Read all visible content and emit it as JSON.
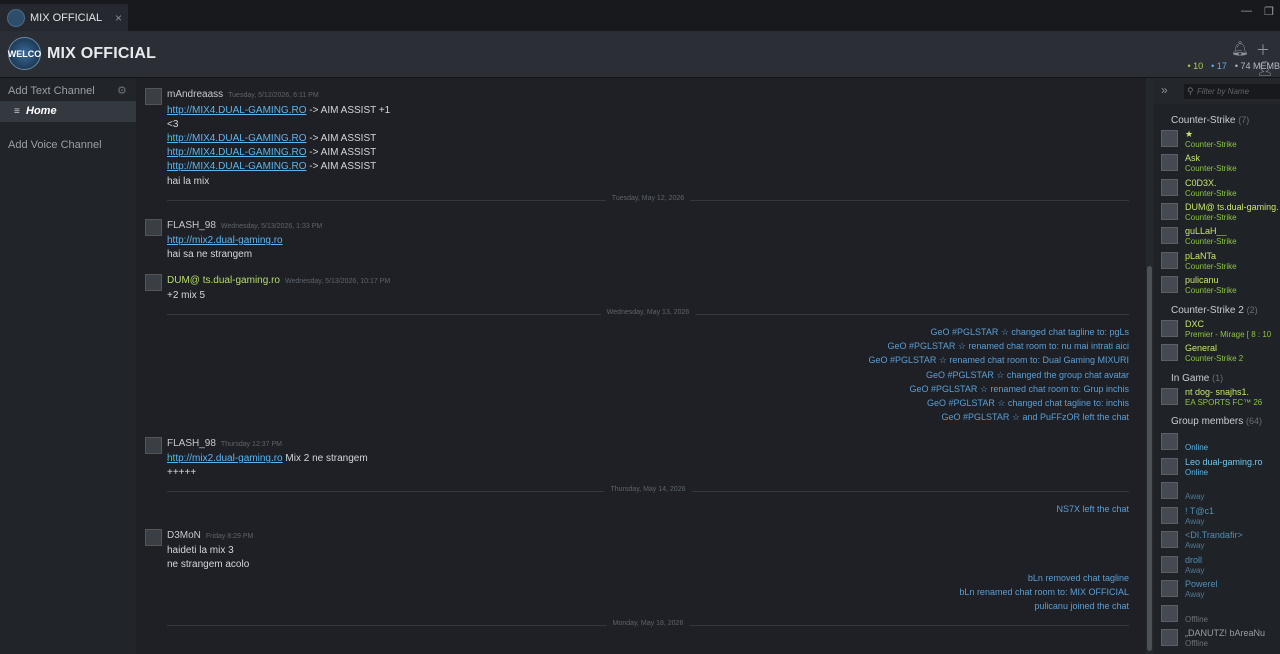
{
  "tab": {
    "title": "MIX OFFICIAL",
    "close": "×"
  },
  "header": {
    "title": "MIX OFFICIAL",
    "logo_text": "WELCO",
    "counts": {
      "in_game": "10",
      "online": "17",
      "members": "74 MEMB"
    }
  },
  "left": {
    "add_text": "Add Text Channel",
    "home": "Home",
    "add_voice": "Add Voice Channel"
  },
  "messages": [
    {
      "name": "mAndreaass",
      "ts": "Tuesday, 5/12/2026, 6:11 PM",
      "lines": [
        {
          "link": "http://MIX4.DUAL-GAMING.RO",
          "text": " -> AIM ASSIST +1"
        },
        {
          "text": "<3"
        },
        {
          "link": "http://MIX4.DUAL-GAMING.RO",
          "text": " -> AIM ASSIST"
        },
        {
          "link": "http://MIX4.DUAL-GAMING.RO",
          "text": " -> AIM ASSIST"
        },
        {
          "link": "http://MIX4.DUAL-GAMING.RO",
          "text": " -> AIM ASSIST"
        },
        {
          "text": "hai la mix"
        }
      ]
    },
    {
      "name": "FLASH_98",
      "ts": "Wednesday, 5/13/2026, 1:33 PM",
      "lines": [
        {
          "link": "http://mix2.dual-gaming.ro",
          "text": ""
        },
        {
          "text": "hai sa ne strangem"
        }
      ]
    },
    {
      "name": "DUM@ ts.dual-gaming.ro",
      "ts": "Wednesday, 5/13/2026, 10:17 PM",
      "lines": [
        {
          "text": "+2 mix 5"
        }
      ]
    },
    {
      "name": "FLASH_98",
      "ts": "Thursday 12:37 PM",
      "lines": [
        {
          "link": "http://mix2.dual-gaming.ro",
          "text": " Mix 2 ne strangem"
        },
        {
          "text": "+++++"
        }
      ]
    },
    {
      "name": "D3MoN",
      "ts": "Friday 8:29 PM",
      "lines": [
        {
          "text": "haideti la mix 3"
        },
        {
          "text": "ne strangem acolo"
        }
      ]
    }
  ],
  "separators": [
    "Tuesday, May 12, 2026",
    "Wednesday, May 13, 2026",
    "Thursday, May 14, 2026",
    "Monday, May 18, 2026"
  ],
  "system": {
    "block1": [
      "GeO #PGLSTAR ☆ changed chat tagline to: pgLs",
      "GeO #PGLSTAR ☆ renamed chat room to: nu mai intrati aici",
      "GeO #PGLSTAR ☆ renamed chat room to: Dual Gaming MIXURI",
      "GeO #PGLSTAR ☆ changed the group chat avatar",
      "GeO #PGLSTAR ☆ renamed chat room to: Grup inchis",
      "GeO #PGLSTAR ☆ changed chat tagline to: inchis",
      "GeO #PGLSTAR ☆ and PuFFzOR left the chat"
    ],
    "block2": [
      "NS7X left the chat"
    ],
    "block3": [
      "bLn removed chat tagline",
      "bLn renamed chat room to: MIX OFFICIAL",
      "pulicanu joined the chat"
    ]
  },
  "right": {
    "filter": "Filter by Name",
    "groups": [
      {
        "title": "Counter-Strike",
        "count": "(7)"
      },
      {
        "title": "Counter-Strike 2",
        "count": "(2)"
      },
      {
        "title": "In Game",
        "count": "(1)"
      },
      {
        "title": "Group members",
        "count": "(64)"
      }
    ],
    "cs": [
      {
        "name": "★",
        "status": "Counter-Strike"
      },
      {
        "name": "Ask",
        "status": "Counter-Strike"
      },
      {
        "name": "C0D3X.",
        "status": "Counter-Strike"
      },
      {
        "name": "DUM@ ts.dual-gaming.",
        "status": "Counter-Strike"
      },
      {
        "name": "guLLaH__",
        "status": "Counter-Strike"
      },
      {
        "name": "pLaNTa",
        "status": "Counter-Strike"
      },
      {
        "name": "pulicanu",
        "status": "Counter-Strike"
      }
    ],
    "cs2": [
      {
        "name": "DXC",
        "status": "Premier - Mirage [ 8 : 10"
      },
      {
        "name": "General",
        "status": "Counter-Strike 2"
      }
    ],
    "ingame": [
      {
        "name": "nt dog- snajhs1.",
        "status": "EA SPORTS FC™ 26"
      }
    ],
    "members": [
      {
        "name": "",
        "status": "Online",
        "cls": "on"
      },
      {
        "name": "Leo dual-gaming.ro",
        "status": "Online",
        "cls": "on"
      },
      {
        "name": "",
        "status": "Away",
        "cls": "aw"
      },
      {
        "name": "! T@c1",
        "status": "Away",
        "cls": "aw"
      },
      {
        "name": "<DI.Trandafir>",
        "status": "Away",
        "cls": "aw"
      },
      {
        "name": "droll",
        "status": "Away",
        "cls": "aw"
      },
      {
        "name": "Powerel",
        "status": "Away",
        "cls": "aw"
      },
      {
        "name": "",
        "status": "Offline",
        "cls": "off"
      },
      {
        "name": "„DANUTZ! bAreaNu",
        "status": "Offline",
        "cls": "off"
      }
    ]
  }
}
